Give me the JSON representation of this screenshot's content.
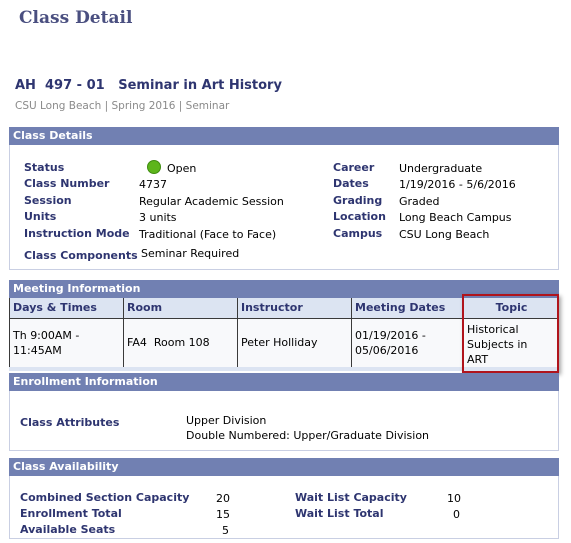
{
  "page_title": "Class Detail",
  "class_title": "AH  497 - 01   Seminar in Art History",
  "class_subtitle": "CSU Long Beach | Spring 2016 | Seminar",
  "class_details": {
    "header": "Class Details",
    "status_label": "Status",
    "status_value": "Open",
    "status_color": "#5db51b",
    "class_number_label": "Class Number",
    "class_number_value": "4737",
    "session_label": "Session",
    "session_value": "Regular Academic Session",
    "units_label": "Units",
    "units_value": "3 units",
    "instruction_mode_label": "Instruction Mode",
    "instruction_mode_value": "Traditional (Face to Face)",
    "class_components_label": "Class Components",
    "class_components_value": "Seminar Required",
    "career_label": "Career",
    "career_value": "Undergraduate",
    "dates_label": "Dates",
    "dates_value": "1/19/2016 - 5/6/2016",
    "grading_label": "Grading",
    "grading_value": "Graded",
    "location_label": "Location",
    "location_value": "Long Beach Campus",
    "campus_label": "Campus",
    "campus_value": "CSU Long Beach"
  },
  "meeting_information": {
    "header": "Meeting Information",
    "columns": [
      "Days & Times",
      "Room",
      "Instructor",
      "Meeting Dates",
      "Topic"
    ],
    "rows": [
      {
        "days_times_1": "Th 9:00AM -",
        "days_times_2": "11:45AM",
        "room": "FA4  Room 108",
        "instructor": "Peter Holliday",
        "meeting_dates_1": "01/19/2016 -",
        "meeting_dates_2": "05/06/2016",
        "topic_1": "Historical",
        "topic_2": "Subjects in",
        "topic_3": "ART"
      }
    ]
  },
  "enrollment_information": {
    "header": "Enrollment Information",
    "class_attributes_label": "Class Attributes",
    "class_attributes_values": [
      "Upper Division",
      "Double Numbered: Upper/Graduate Division"
    ]
  },
  "class_availability": {
    "header": "Class Availability",
    "combined_section_capacity_label": "Combined Section Capacity",
    "combined_section_capacity_value": "20",
    "enrollment_total_label": "Enrollment Total",
    "enrollment_total_value": "15",
    "available_seats_label": "Available Seats",
    "available_seats_value": "5",
    "wait_list_capacity_label": "Wait List Capacity",
    "wait_list_capacity_value": "10",
    "wait_list_total_label": "Wait List Total",
    "wait_list_total_value": "0"
  }
}
